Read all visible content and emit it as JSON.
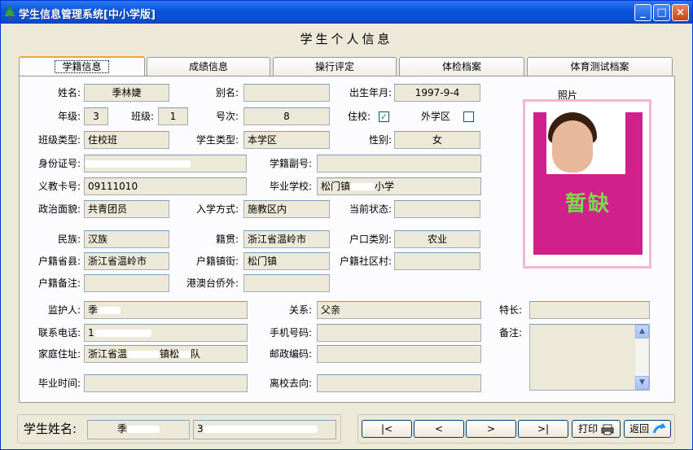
{
  "window": {
    "title": "学生信息管理系统[中小学版]",
    "min": "_",
    "max": "□",
    "close": "×"
  },
  "form_title": "学生个人信息",
  "tabs": [
    "学籍信息",
    "成绩信息",
    "操行评定",
    "体检档案",
    "体育测试档案"
  ],
  "fields": {
    "name_label": "姓名:",
    "name": "季林婕",
    "alias_label": "别名:",
    "alias": "",
    "birth_label": "出生年月:",
    "birth": "1997-9-4",
    "grade_label": "年级:",
    "grade": "3",
    "class_label": "班级:",
    "class": "1",
    "seat_label": "号次:",
    "seat": "8",
    "boarding_label": "住校:",
    "boarding_checked": "✓",
    "outside_label": "外学区",
    "classtype_label": "班级类型:",
    "classtype": "住校班",
    "studtype_label": "学生类型:",
    "studtype": "本学区",
    "gender_label": "性别:",
    "gender": "女",
    "id_label": "身份证号:",
    "subno_label": "学籍副号:",
    "subno": "",
    "card_label": "义教卡号:",
    "card": "09111010",
    "school_label": "毕业学校:",
    "school_a": "松门镇",
    "school_b": "小学",
    "political_label": "政治面貌:",
    "political": "共青团员",
    "entry_label": "入学方式:",
    "entry": "施教区内",
    "status_label": "当前状态:",
    "status": "",
    "ethnic_label": "民族:",
    "ethnic": "汉族",
    "native_label": "籍贯:",
    "native": "浙江省温岭市",
    "hukou_label": "户口类别:",
    "hukou": "农业",
    "hprov_label": "户籍省县:",
    "hprov": "浙江省温岭市",
    "htown_label": "户籍镇街:",
    "htown": "松门镇",
    "hcomm_label": "户籍社区村:",
    "hcomm": "",
    "hnote_label": "户籍备注:",
    "hnote": "",
    "hk_label": "港澳台侨外:",
    "hk": "",
    "guardian_label": "监护人:",
    "guardian": "季",
    "relation_label": "关系:",
    "relation": "父亲",
    "talent_label": "特长:",
    "talent": "",
    "phone_label": "联系电话:",
    "phone": "1",
    "mobile_label": "手机号码:",
    "mobile": "",
    "remark_label": "备注:",
    "remark": "",
    "address_label": "家庭住址:",
    "address_a": "浙江省温",
    "address_b": "镇松",
    "address_c": "队",
    "postal_label": "邮政编码:",
    "postal": "",
    "gradtime_label": "毕业时间:",
    "gradtime": "",
    "leave_label": "离校去向:",
    "leave": ""
  },
  "photo": {
    "label": "照片",
    "placeholder": "暂缺"
  },
  "bottom": {
    "student_label": "学生姓名:",
    "student_name": "季",
    "student_id": "3",
    "first": "|<",
    "prev": "<",
    "next": ">",
    "last": ">|",
    "print": "打印",
    "back": "返回"
  }
}
